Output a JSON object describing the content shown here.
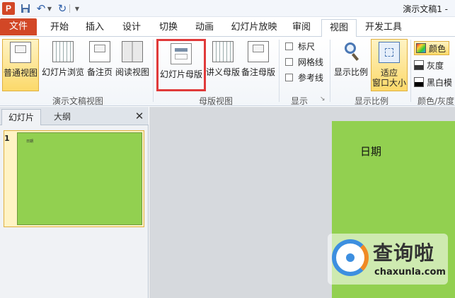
{
  "titlebar": {
    "app_icon": "P",
    "title": "演示文稿1 -",
    "icons": [
      "powerpoint-icon",
      "save-icon",
      "undo-icon",
      "redo-icon",
      "customize-icon"
    ]
  },
  "tabs": [
    {
      "label": "文件"
    },
    {
      "label": "开始"
    },
    {
      "label": "插入"
    },
    {
      "label": "设计"
    },
    {
      "label": "切换"
    },
    {
      "label": "动画"
    },
    {
      "label": "幻灯片放映"
    },
    {
      "label": "审阅"
    },
    {
      "label": "视图"
    },
    {
      "label": "开发工具"
    }
  ],
  "active_tab": "视图",
  "ribbon": {
    "presentation_views": {
      "group_label": "演示文稿视图",
      "buttons": [
        "普通视图",
        "幻灯片浏览",
        "备注页",
        "阅读视图"
      ]
    },
    "master_views": {
      "group_label": "母版视图",
      "buttons": [
        "幻灯片母版",
        "讲义母版",
        "备注母版"
      ]
    },
    "show": {
      "group_label": "显示",
      "checkboxes": [
        {
          "label": "标尺",
          "checked": false
        },
        {
          "label": "网格线",
          "checked": false
        },
        {
          "label": "参考线",
          "checked": false
        }
      ]
    },
    "zoom": {
      "group_label": "显示比例",
      "buttons": [
        "显示比例",
        "适应",
        "窗口大小"
      ]
    },
    "color": {
      "group_label": "颜色/灰度",
      "options": [
        "颜色",
        "灰度",
        "黑白模"
      ]
    }
  },
  "left_pane": {
    "tabs": [
      "幻灯片",
      "大纲"
    ],
    "close": "✕",
    "slide_number": "1",
    "thumb_text": "日期"
  },
  "canvas": {
    "slide_text": "日期",
    "slide_color": "#92d050"
  },
  "watermark": {
    "title": "查询啦",
    "domain": "chaxunla.com"
  },
  "colors": {
    "file_tab": "#d24726",
    "selected": "#fcd96a",
    "highlight_box": "#e03a3a",
    "slide_green": "#92d050"
  }
}
